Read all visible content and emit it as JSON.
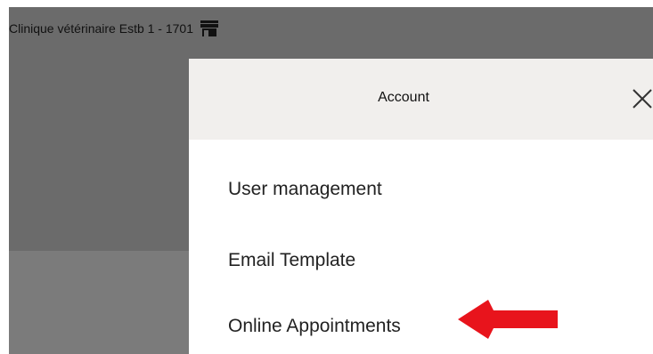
{
  "clinic": {
    "name": "Clinique vétérinaire Estb 1 - 1701",
    "icon": "store-icon"
  },
  "panel": {
    "title": "Account",
    "close_icon": "close-icon"
  },
  "menu": {
    "items": [
      {
        "label": "User management"
      },
      {
        "label": "Email Template"
      },
      {
        "label": "Online Appointments"
      }
    ]
  },
  "annotation": {
    "arrow_color": "#e8141c"
  }
}
